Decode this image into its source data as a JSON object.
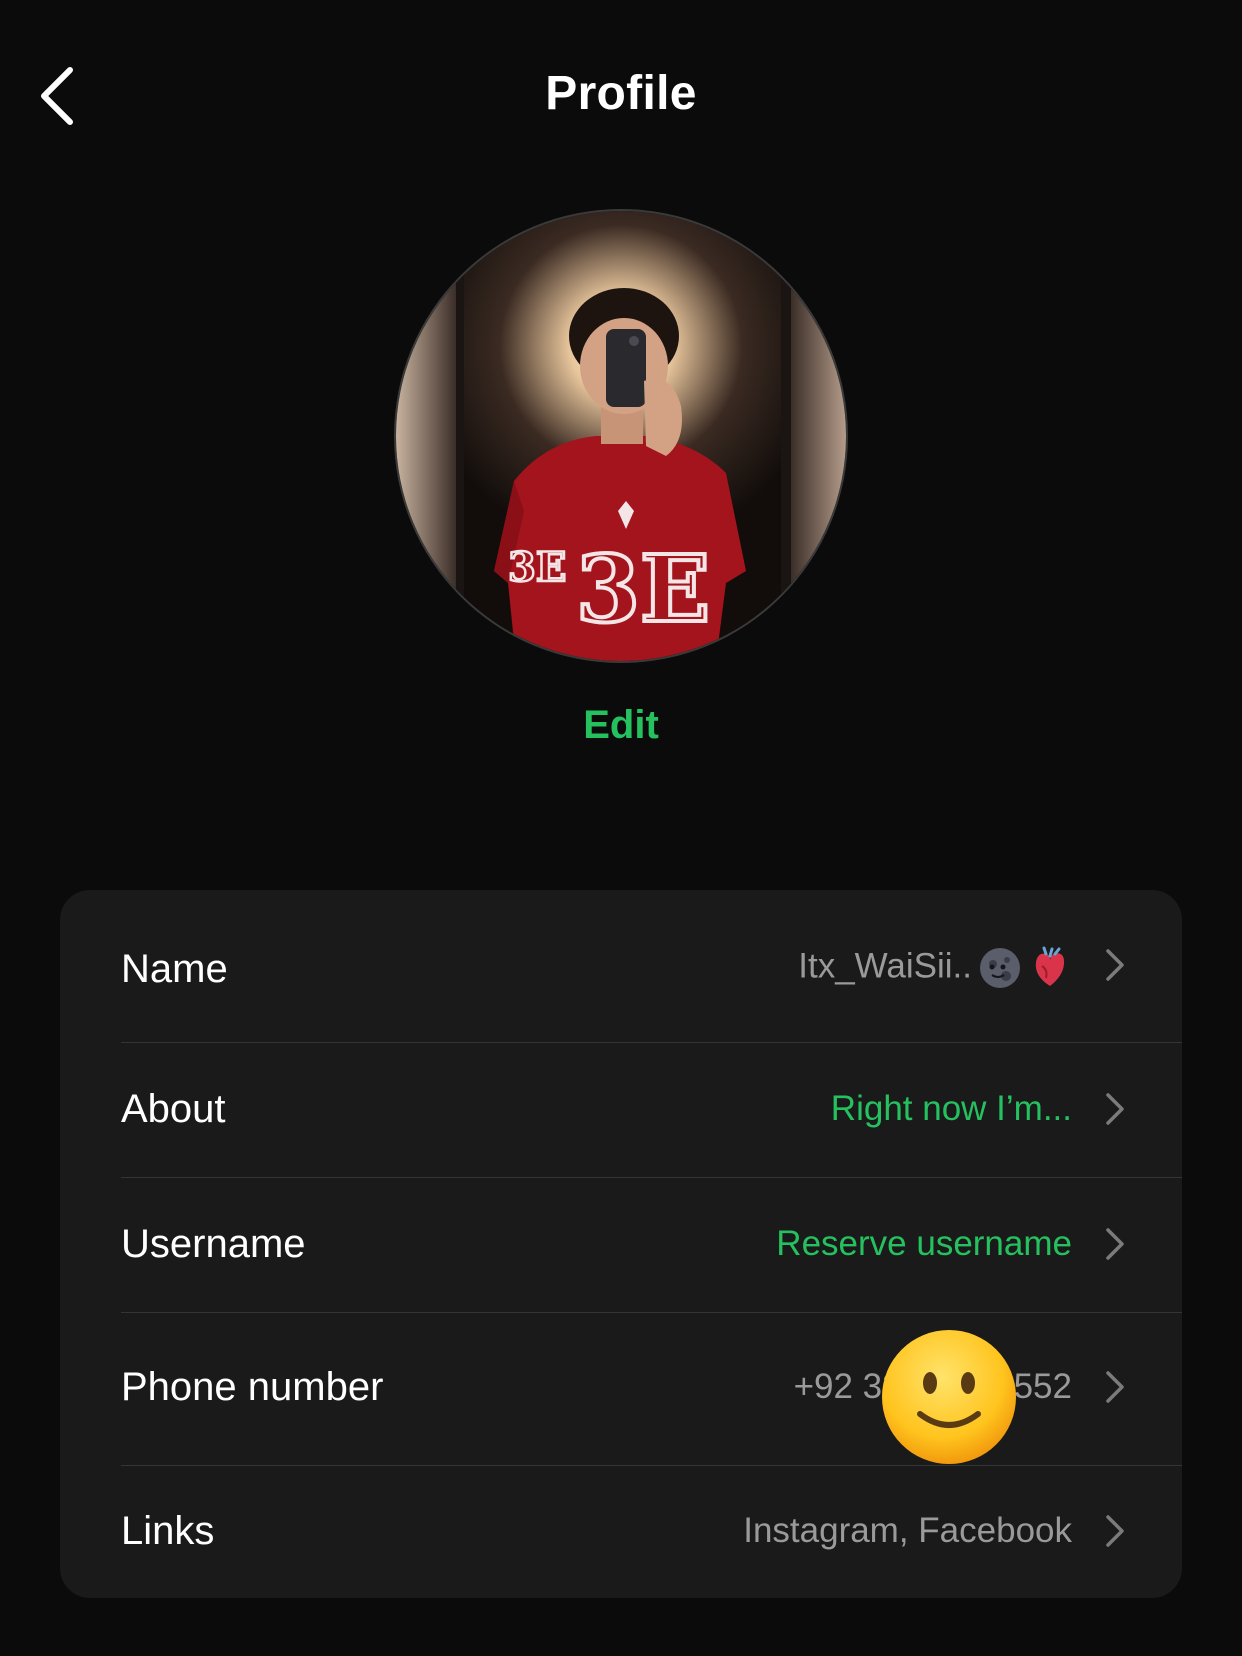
{
  "header": {
    "title": "Profile",
    "back_icon": "chevron-left-icon"
  },
  "profile_photo": {
    "edit_label": "Edit"
  },
  "accent_color": "#25c15f",
  "rows": [
    {
      "label": "Name",
      "value": "Itx_WaiSii..",
      "value_emojis": [
        "new-moon-face-icon",
        "anatomical-heart-icon"
      ],
      "value_color": "gray"
    },
    {
      "label": "About",
      "value": "Right now I’m...",
      "value_color": "green"
    },
    {
      "label": "Username",
      "value": "Reserve username",
      "value_color": "green"
    },
    {
      "label": "Phone number",
      "value_start": "+92 33",
      "value_end": "552",
      "value_color": "gray"
    },
    {
      "label": "Links",
      "value": "Instagram, Facebook",
      "value_color": "gray"
    }
  ],
  "overlay_sticker": "slightly-smiling-face-icon"
}
